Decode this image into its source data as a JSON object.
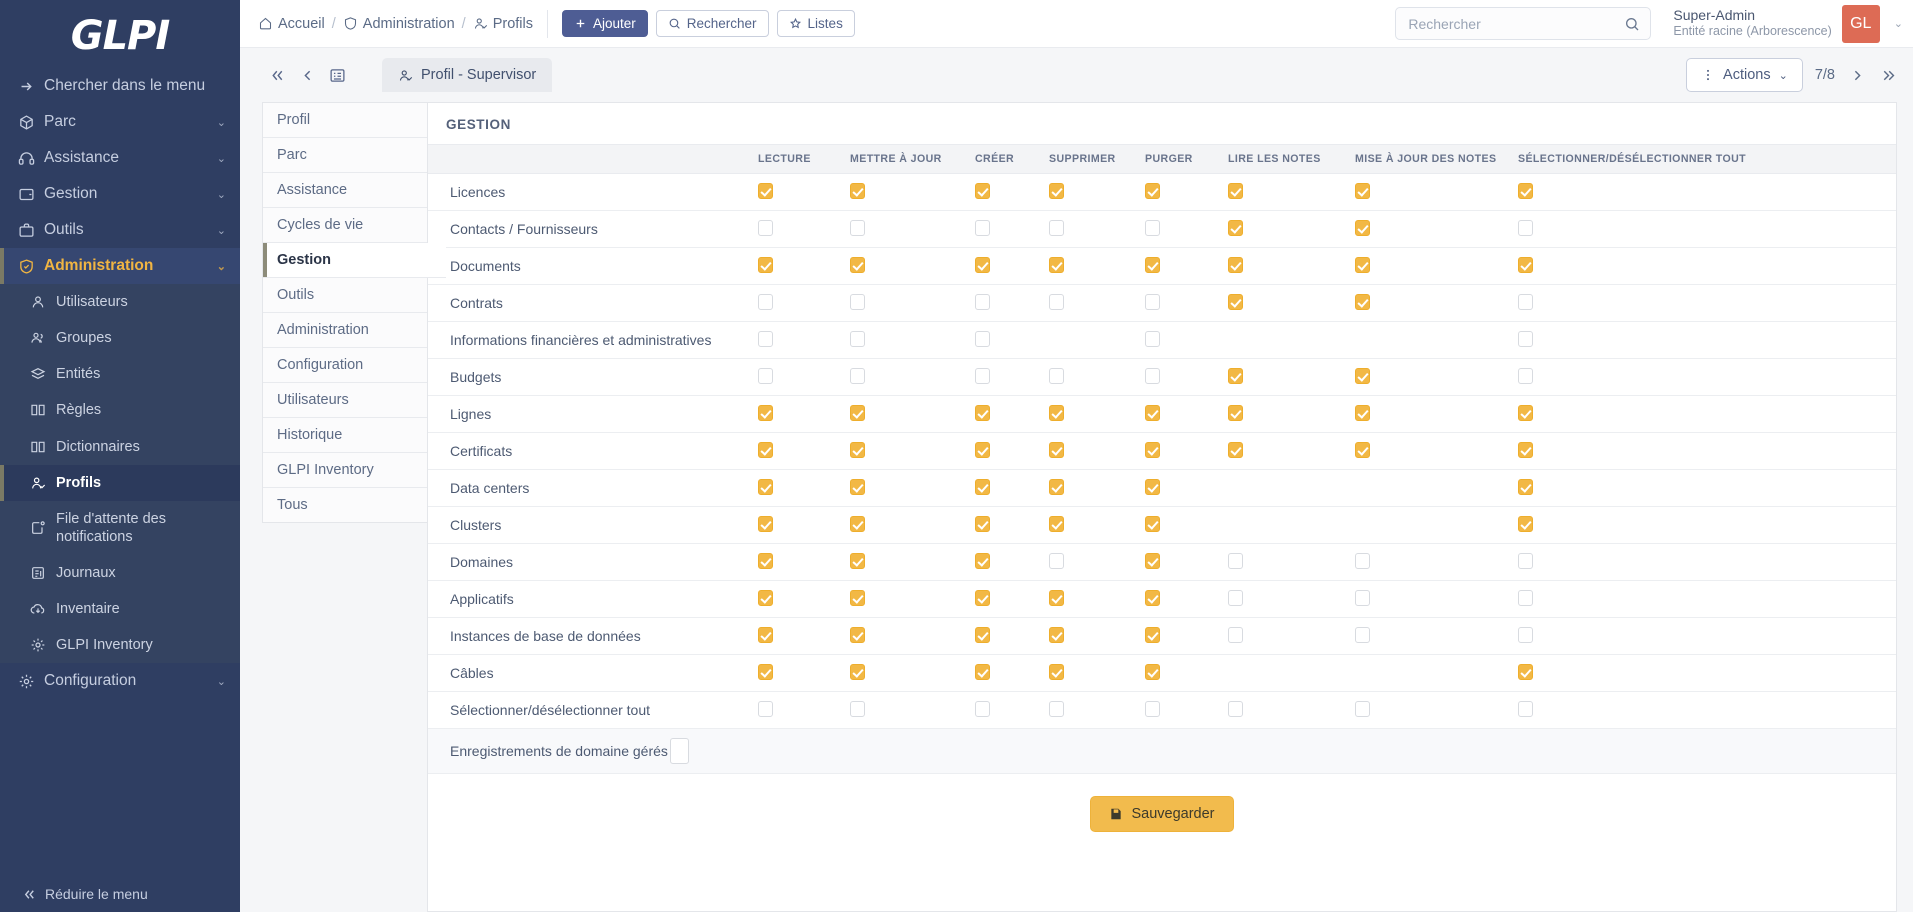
{
  "sidebar": {
    "logo": "GLPI",
    "search_menu_label": "Chercher dans le menu",
    "items": [
      {
        "label": "Parc",
        "icon": "box-icon",
        "expandable": true
      },
      {
        "label": "Assistance",
        "icon": "headset-icon",
        "expandable": true
      },
      {
        "label": "Gestion",
        "icon": "wallet-icon",
        "expandable": true
      },
      {
        "label": "Outils",
        "icon": "briefcase-icon",
        "expandable": true
      },
      {
        "label": "Administration",
        "icon": "shield-icon",
        "expandable": true,
        "active": true
      },
      {
        "label": "Configuration",
        "icon": "gear-icon",
        "expandable": true
      }
    ],
    "admin_subitems": [
      {
        "label": "Utilisateurs",
        "icon": "user-icon"
      },
      {
        "label": "Groupes",
        "icon": "users-icon"
      },
      {
        "label": "Entités",
        "icon": "layers-icon"
      },
      {
        "label": "Règles",
        "icon": "book-icon"
      },
      {
        "label": "Dictionnaires",
        "icon": "book-icon"
      },
      {
        "label": "Profils",
        "icon": "user-check-icon",
        "selected": true
      },
      {
        "label": "File d'attente des notifications",
        "icon": "notification-queue-icon"
      },
      {
        "label": "Journaux",
        "icon": "logs-icon"
      },
      {
        "label": "Inventaire",
        "icon": "cloud-download-icon"
      },
      {
        "label": "GLPI Inventory",
        "icon": "gear-icon"
      }
    ],
    "collapse_label": "Réduire le menu"
  },
  "topbar": {
    "breadcrumbs": [
      {
        "label": "Accueil",
        "icon": "home-icon"
      },
      {
        "label": "Administration",
        "icon": "shield-icon"
      },
      {
        "label": "Profils",
        "icon": "user-check-icon"
      }
    ],
    "buttons": [
      {
        "label": "Ajouter",
        "icon": "plus-icon",
        "style": "primary"
      },
      {
        "label": "Rechercher",
        "icon": "search-icon",
        "style": "outline"
      },
      {
        "label": "Listes",
        "icon": "star-icon",
        "style": "outline"
      }
    ],
    "search": {
      "placeholder": "Rechercher",
      "value": "",
      "icon": "search-icon"
    },
    "user": {
      "name": "Super-Admin",
      "entity": "Entité racine (Arborescence)",
      "initials": "GL"
    }
  },
  "toolbar": {
    "nav_icons": [
      "chevrons-left-icon",
      "chevron-left-icon",
      "list-icon"
    ],
    "tab_title": "Profil - Supervisor",
    "tab_title_icon": "user-check-icon",
    "actions_label": "Actions",
    "pager": {
      "position": "7/8",
      "next_icon": "chevron-right-icon",
      "last_icon": "chevrons-right-icon"
    }
  },
  "side_tabs": [
    {
      "label": "Profil"
    },
    {
      "label": "Parc"
    },
    {
      "label": "Assistance"
    },
    {
      "label": "Cycles de vie"
    },
    {
      "label": "Gestion",
      "active": true
    },
    {
      "label": "Outils"
    },
    {
      "label": "Administration"
    },
    {
      "label": "Configuration"
    },
    {
      "label": "Utilisateurs"
    },
    {
      "label": "Historique"
    },
    {
      "label": "GLPI Inventory"
    },
    {
      "label": "Tous"
    }
  ],
  "panel": {
    "title": "GESTION",
    "columns": [
      "",
      "LECTURE",
      "METTRE À JOUR",
      "CRÉER",
      "SUPPRIMER",
      "PURGER",
      "LIRE LES NOTES",
      "MISE À JOUR DES NOTES",
      "SÉLECTIONNER/DÉSÉLECTIONNER TOUT"
    ],
    "rows": [
      {
        "label": "Licences",
        "cells": [
          "on",
          "on",
          "on",
          "on",
          "on",
          "on",
          "on",
          "on"
        ]
      },
      {
        "label": "Contacts / Fournisseurs",
        "cells": [
          "off",
          "off",
          "off",
          "off",
          "off",
          "on",
          "on",
          "off"
        ]
      },
      {
        "label": "Documents",
        "cells": [
          "on",
          "on",
          "on",
          "on",
          "on",
          "on",
          "on",
          "on"
        ]
      },
      {
        "label": "Contrats",
        "cells": [
          "off",
          "off",
          "off",
          "off",
          "off",
          "on",
          "on",
          "off"
        ]
      },
      {
        "label": "Informations financières et administratives",
        "cells": [
          "off",
          "off",
          "off",
          "blank",
          "off",
          "blank",
          "blank",
          "off"
        ]
      },
      {
        "label": "Budgets",
        "cells": [
          "off",
          "off",
          "off",
          "off",
          "off",
          "on",
          "on",
          "off"
        ]
      },
      {
        "label": "Lignes",
        "cells": [
          "on",
          "on",
          "on",
          "on",
          "on",
          "on",
          "on",
          "on"
        ]
      },
      {
        "label": "Certificats",
        "cells": [
          "on",
          "on",
          "on",
          "on",
          "on",
          "on",
          "on",
          "on"
        ]
      },
      {
        "label": "Data centers",
        "cells": [
          "on",
          "on",
          "on",
          "on",
          "on",
          "blank",
          "blank",
          "on"
        ]
      },
      {
        "label": "Clusters",
        "cells": [
          "on",
          "on",
          "on",
          "on",
          "on",
          "blank",
          "blank",
          "on"
        ]
      },
      {
        "label": "Domaines",
        "cells": [
          "on",
          "on",
          "on",
          "off",
          "on",
          "off",
          "off",
          "off"
        ]
      },
      {
        "label": "Applicatifs",
        "cells": [
          "on",
          "on",
          "on",
          "on",
          "on",
          "off",
          "off",
          "off"
        ]
      },
      {
        "label": "Instances de base de données",
        "cells": [
          "on",
          "on",
          "on",
          "on",
          "on",
          "off",
          "off",
          "off"
        ]
      },
      {
        "label": "Câbles",
        "cells": [
          "on",
          "on",
          "on",
          "on",
          "on",
          "blank",
          "blank",
          "on"
        ]
      },
      {
        "label": "Sélectionner/désélectionner tout",
        "cells": [
          "off",
          "off",
          "off",
          "off",
          "off",
          "off",
          "off",
          "off"
        ]
      }
    ],
    "extra_field": {
      "label": "Enregistrements de domaine gérés",
      "value": ""
    },
    "save_label": "Sauvegarder",
    "save_icon": "save-icon"
  },
  "colors": {
    "sidebar_bg": "#2f3e62",
    "accent_yellow": "#f2b845",
    "primary_blue": "#4e5d94",
    "avatar_red": "#dd6b55"
  }
}
